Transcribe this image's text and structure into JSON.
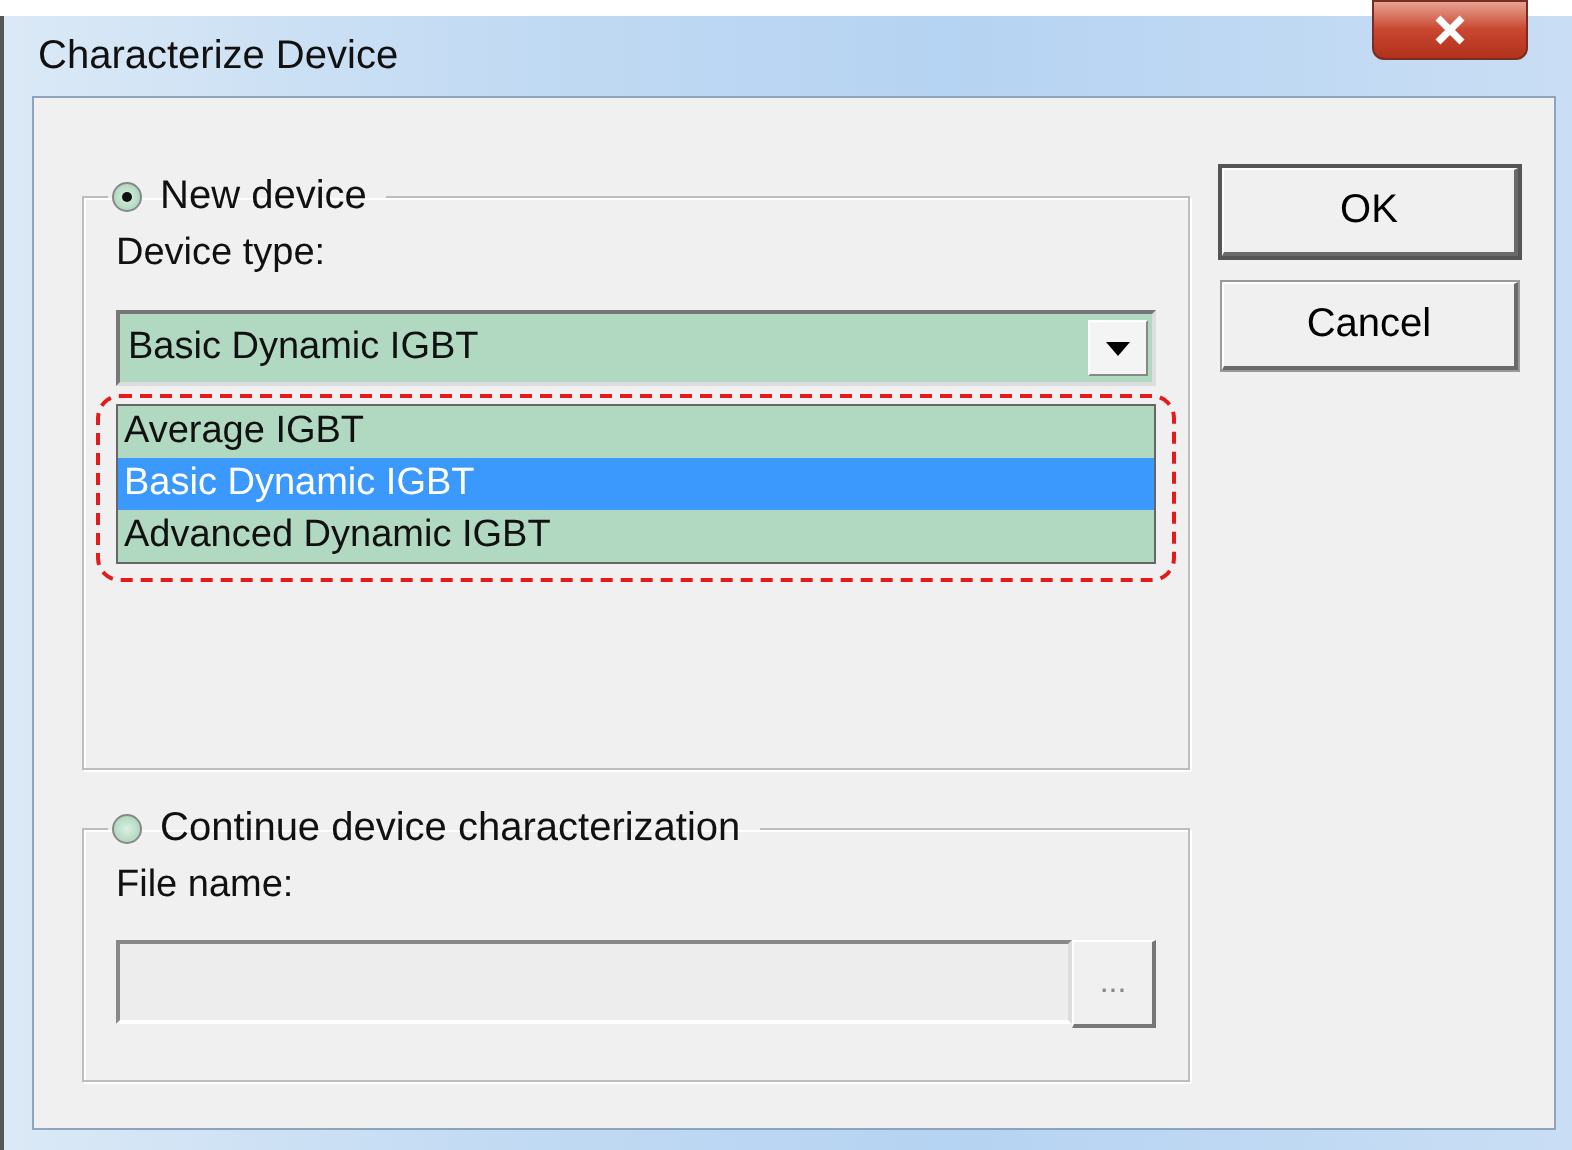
{
  "window": {
    "title": "Characterize Device"
  },
  "new_device": {
    "label": "New device",
    "selected": true,
    "device_type_label": "Device type:",
    "combo_value": "Basic Dynamic IGBT",
    "options": [
      {
        "label": "Average IGBT",
        "selected": false
      },
      {
        "label": "Basic Dynamic IGBT",
        "selected": true
      },
      {
        "label": "Advanced Dynamic IGBT",
        "selected": false
      }
    ],
    "highlighted": true
  },
  "continue": {
    "label": "Continue device characterization",
    "selected": false,
    "file_name_label": "File name:",
    "browse_label": "...",
    "disabled": true
  },
  "buttons": [
    "OK",
    "Cancel"
  ]
}
